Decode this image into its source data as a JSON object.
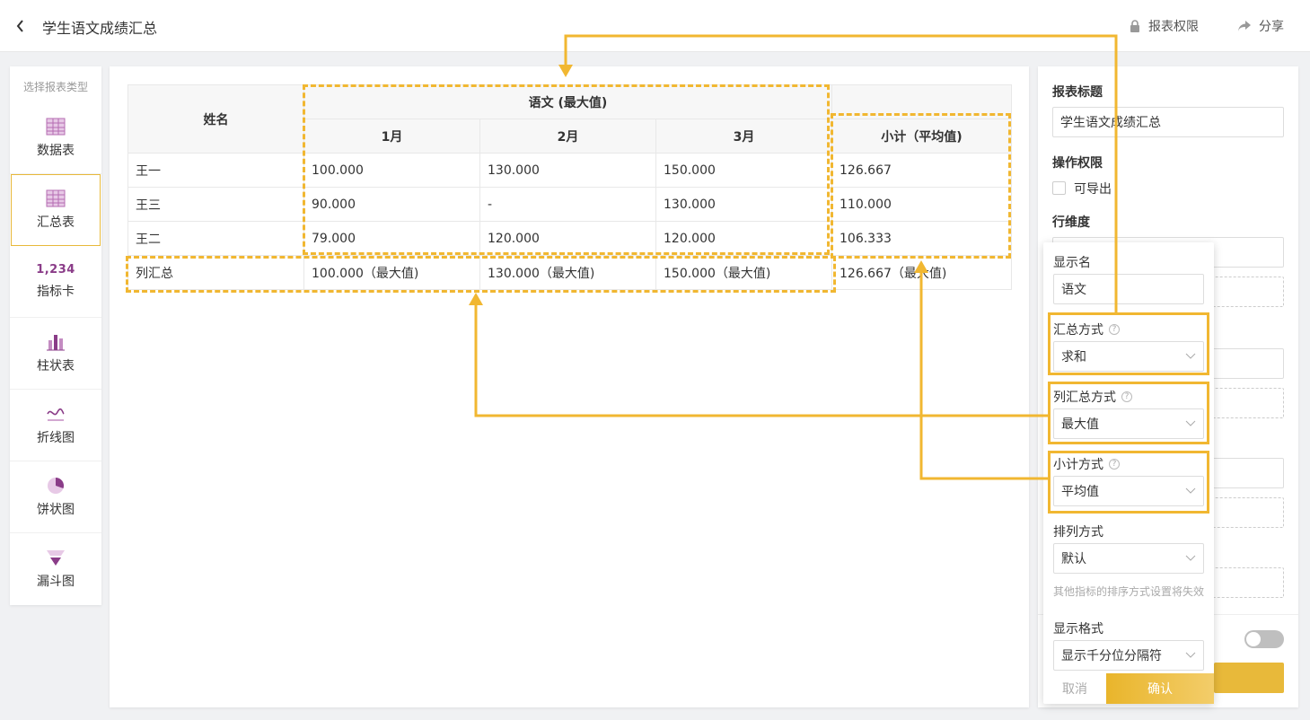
{
  "header": {
    "title": "学生语文成绩汇总",
    "permissions_label": "报表权限",
    "share_label": "分享"
  },
  "sidebar": {
    "title": "选择报表类型",
    "items": [
      {
        "label": "数据表",
        "icon": "table-icon"
      },
      {
        "label": "汇总表",
        "icon": "summary-table-icon",
        "active": true
      },
      {
        "label": "指标卡",
        "icon": "number-card-icon",
        "icon_text": "1,234"
      },
      {
        "label": "柱状表",
        "icon": "bar-chart-icon"
      },
      {
        "label": "折线图",
        "icon": "line-chart-icon"
      },
      {
        "label": "饼状图",
        "icon": "pie-chart-icon"
      },
      {
        "label": "漏斗图",
        "icon": "funnel-chart-icon"
      }
    ]
  },
  "table": {
    "row_header": "姓名",
    "group_header": "语文 (最大值)",
    "months": [
      "1月",
      "2月",
      "3月"
    ],
    "subtotal_header": "小计（平均值)",
    "rows": [
      {
        "name": "王一",
        "m1": "100.000",
        "m2": "130.000",
        "m3": "150.000",
        "subtotal": "126.667"
      },
      {
        "name": "王三",
        "m1": "90.000",
        "m2": "-",
        "m3": "130.000",
        "subtotal": "110.000"
      },
      {
        "name": "王二",
        "m1": "79.000",
        "m2": "120.000",
        "m3": "120.000",
        "subtotal": "106.333"
      }
    ],
    "total_row": {
      "name": "列汇总",
      "m1": "100.000（最大值)",
      "m2": "130.000（最大值)",
      "m3": "150.000（最大值)",
      "subtotal": "126.667（最大值)"
    }
  },
  "right_panel": {
    "report_title_label": "报表标题",
    "report_title_value": "学生语文成绩汇总",
    "ops_label": "操作权限",
    "export_label": "可导出",
    "row_dim_label": "行维度"
  },
  "popover": {
    "display_name_label": "显示名",
    "display_name_value": "语文",
    "agg_label": "汇总方式",
    "agg_value": "求和",
    "col_agg_label": "列汇总方式",
    "col_agg_value": "最大值",
    "subtotal_label": "小计方式",
    "subtotal_value": "平均值",
    "sort_label": "排列方式",
    "sort_value": "默认",
    "sort_hint": "其他指标的排序方式设置将失效",
    "format_label": "显示格式",
    "format_value": "显示千分位分隔符",
    "cancel_label": "取消",
    "confirm_label": "确认"
  },
  "colors": {
    "accent": "#f1b731",
    "icon_purple": "#8a3c88",
    "confirm": "#e9b52b"
  }
}
